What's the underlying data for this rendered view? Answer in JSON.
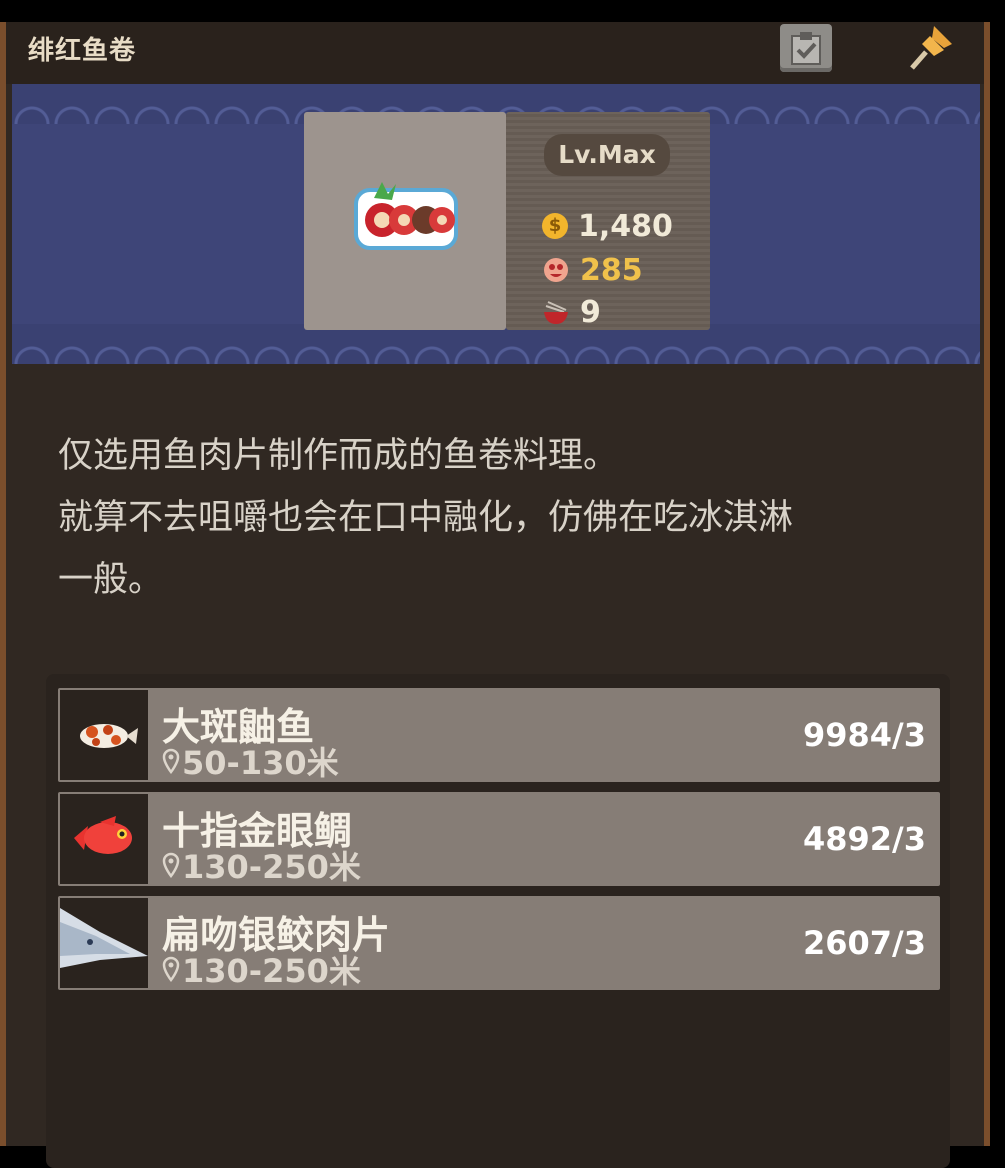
{
  "title": "绯红鱼卷",
  "dish": {
    "level_label": "Lv.Max",
    "price": "1,480",
    "fans": "285",
    "stock": "9"
  },
  "description": [
    "仅选用鱼肉片制作而成的鱼卷料理。",
    "就算不去咀嚼也会在口中融化，仿佛在吃冰淇淋",
    "一般。"
  ],
  "ingredients": [
    {
      "name": "大斑鼬鱼",
      "distance": "50-130米",
      "count": "9984/3"
    },
    {
      "name": "十指金眼鲷",
      "distance": "130-250米",
      "count": "4892/3"
    },
    {
      "name": "扁吻银鲛肉片",
      "distance": "130-250米",
      "count": "2607/3"
    }
  ],
  "icons": {
    "clipboard": "clipboard-check-icon",
    "pin": "pushpin-icon",
    "coin": "coin-icon",
    "fans": "fan-face-icon",
    "bowl": "bowl-icon",
    "location": "location-pin-icon"
  },
  "colors": {
    "panel_bg": "#302822",
    "banner_bg": "#3e4578",
    "row_bg": "#867d76",
    "gold": "#f0c14b"
  }
}
